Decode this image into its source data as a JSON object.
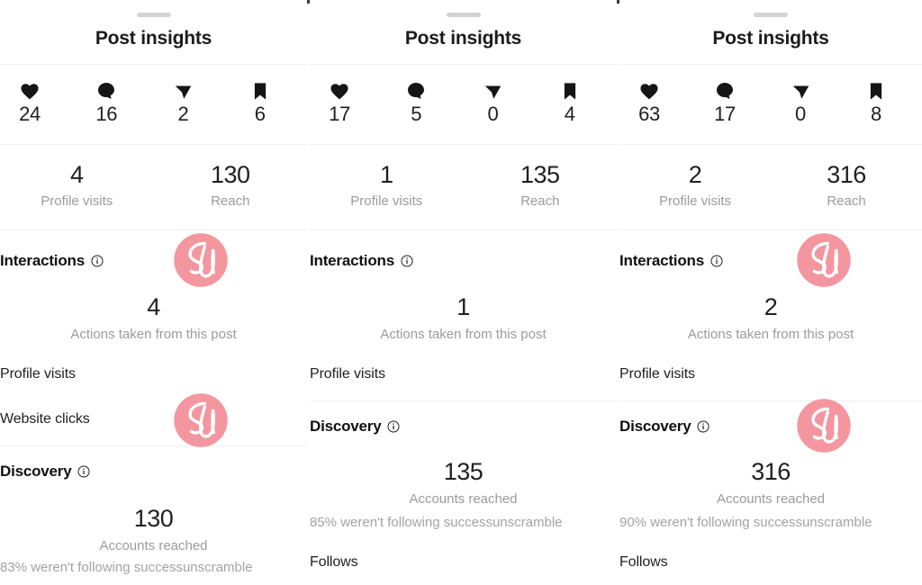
{
  "app": {
    "sheet_title": "Post insights",
    "watermark_label": "SU",
    "watermark_color": "#F4969F",
    "accent_text_color": "#9b9b9b"
  },
  "labels": {
    "profile_visits": "Profile visits",
    "reach": "Reach",
    "interactions": "Interactions",
    "discovery": "Discovery",
    "actions_caption": "Actions taken from this post",
    "accounts_reached_caption": "Accounts reached",
    "website_clicks": "Website clicks",
    "follows": "Follows",
    "info_icon": "info-icon"
  },
  "icons": {
    "like": "heart-icon",
    "comment": "comment-icon",
    "share": "share-icon",
    "save": "bookmark-icon"
  },
  "panels": [
    {
      "title": "Post insights",
      "engagement": [
        {
          "icon": "heart-icon",
          "count": "24"
        },
        {
          "icon": "comment-icon",
          "count": "16"
        },
        {
          "icon": "share-icon",
          "count": "2"
        },
        {
          "icon": "bookmark-icon",
          "count": "6"
        }
      ],
      "stats": [
        {
          "value": "4",
          "label": "Profile visits"
        },
        {
          "value": "130",
          "label": "Reach"
        }
      ],
      "interactions": {
        "heading": "Interactions",
        "value": "4",
        "caption": "Actions taken from this post",
        "rows": [
          "Profile visits",
          "Website clicks"
        ]
      },
      "discovery": {
        "heading": "Discovery",
        "value": "130",
        "caption": "Accounts reached",
        "note": "83% weren't following successunscramble",
        "rows": []
      }
    },
    {
      "title": "Post insights",
      "engagement": [
        {
          "icon": "heart-icon",
          "count": "17"
        },
        {
          "icon": "comment-icon",
          "count": "5"
        },
        {
          "icon": "share-icon",
          "count": "0"
        },
        {
          "icon": "bookmark-icon",
          "count": "4"
        }
      ],
      "stats": [
        {
          "value": "1",
          "label": "Profile visits"
        },
        {
          "value": "135",
          "label": "Reach"
        }
      ],
      "interactions": {
        "heading": "Interactions",
        "value": "1",
        "caption": "Actions taken from this post",
        "rows": [
          "Profile visits"
        ]
      },
      "discovery": {
        "heading": "Discovery",
        "value": "135",
        "caption": "Accounts reached",
        "note": "85% weren't following successunscramble",
        "rows": [
          "Follows"
        ]
      }
    },
    {
      "title": "Post insights",
      "engagement": [
        {
          "icon": "heart-icon",
          "count": "63"
        },
        {
          "icon": "comment-icon",
          "count": "17"
        },
        {
          "icon": "share-icon",
          "count": "0"
        },
        {
          "icon": "bookmark-icon",
          "count": "8"
        }
      ],
      "stats": [
        {
          "value": "2",
          "label": "Profile visits"
        },
        {
          "value": "316",
          "label": "Reach"
        }
      ],
      "interactions": {
        "heading": "Interactions",
        "value": "2",
        "caption": "Actions taken from this post",
        "rows": [
          "Profile visits"
        ]
      },
      "discovery": {
        "heading": "Discovery",
        "value": "316",
        "caption": "Accounts reached",
        "note": "90% weren't following successunscramble",
        "rows": [
          "Follows"
        ]
      }
    }
  ]
}
